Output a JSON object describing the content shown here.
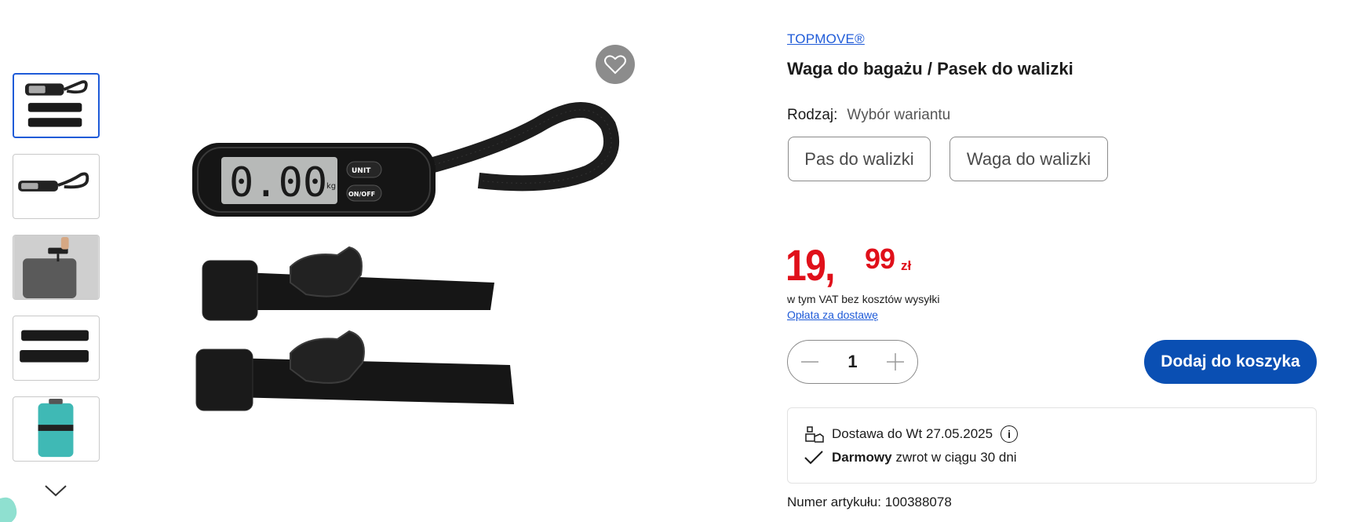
{
  "product": {
    "brand": "TOPMOVE®",
    "title": "Waga do bagażu / Pasek do walizki",
    "variant_label": "Rodzaj:",
    "variant_value": "Wybór wariantu",
    "variants": [
      "Pas do walizki",
      "Waga do walizki"
    ],
    "price_int": "19,",
    "price_dec": "99",
    "currency": "zł",
    "vat_note": "w tym VAT bez kosztów wysyłki",
    "shipping_link": "Opłata za dostawę",
    "quantity": "1",
    "add_to_cart": "Dodaj do koszyka",
    "delivery": "Dostawa do Wt 27.05.2025",
    "info_glyph": "i",
    "free_bold": "Darmowy",
    "free_return": "zwrot w ciągu 30 dni",
    "article_number": "Numer artykułu: 100388078"
  },
  "scale_display": {
    "reading": "0.00",
    "unit": "kg",
    "button_unit": "UNIT",
    "button_power": "ON/OFF"
  },
  "icons": [
    "heart-icon",
    "minus-icon",
    "plus-icon",
    "box-delivery-icon",
    "info-icon",
    "check-icon",
    "chevron-down-icon"
  ],
  "colors": {
    "accent": "#1f5bd8",
    "price": "#e0101a",
    "cta": "#0a4fb3"
  }
}
